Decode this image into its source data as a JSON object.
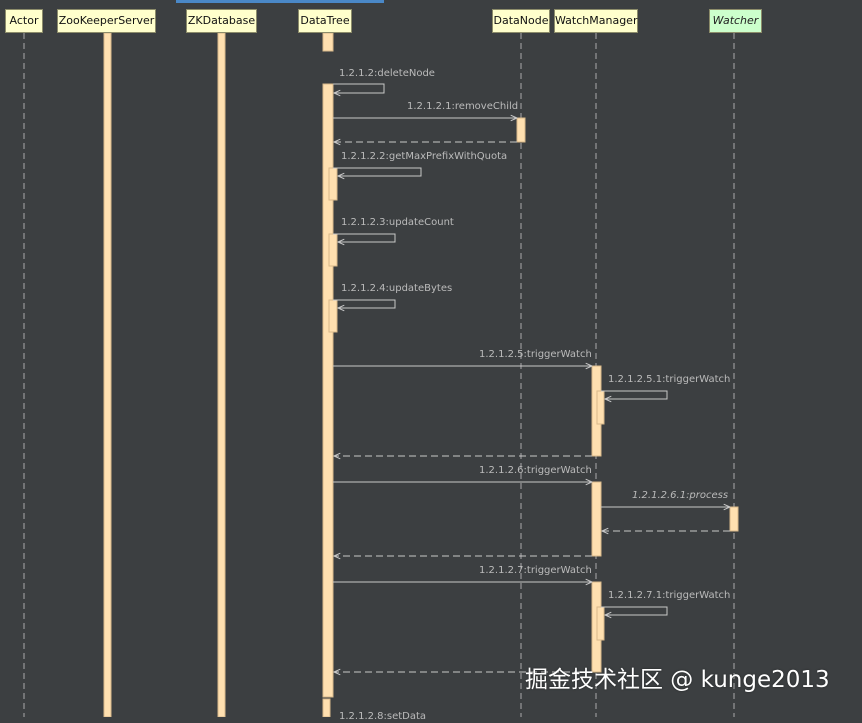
{
  "diagram": {
    "participants": [
      {
        "id": "actor",
        "label": "Actor"
      },
      {
        "id": "zookeeperserver",
        "label": "ZooKeeperServer"
      },
      {
        "id": "zkdatabase",
        "label": "ZKDatabase"
      },
      {
        "id": "datatree",
        "label": "DataTree"
      },
      {
        "id": "datanode",
        "label": "DataNode"
      },
      {
        "id": "watchmanager",
        "label": "WatchManager"
      },
      {
        "id": "watcher",
        "label": "Watcher"
      }
    ],
    "messages": [
      {
        "label": "1.2.1.2:deleteNode"
      },
      {
        "label": "1.2.1.2.1:removeChild"
      },
      {
        "label": "1.2.1.2.2:getMaxPrefixWithQuota"
      },
      {
        "label": "1.2.1.2.3:updateCount"
      },
      {
        "label": "1.2.1.2.4:updateBytes"
      },
      {
        "label": "1.2.1.2.5:triggerWatch"
      },
      {
        "label": "1.2.1.2.5.1:triggerWatch"
      },
      {
        "label": "1.2.1.2.6:triggerWatch"
      },
      {
        "label": "1.2.1.2.6.1:process"
      },
      {
        "label": "1.2.1.2.7:triggerWatch"
      },
      {
        "label": "1.2.1.2.7.1:triggerWatch"
      },
      {
        "label": "1.2.1.2.8:setData"
      }
    ]
  },
  "watermark": "掘金技术社区 @ kunge2013",
  "colors": {
    "background": "#3c3f41",
    "lifeline": "#aaaaaa",
    "activation_fill": "#ffe0b0",
    "arrow": "#c8c8c8",
    "header_fill": "#ffffcc",
    "watcher_fill": "#ccffcc"
  }
}
